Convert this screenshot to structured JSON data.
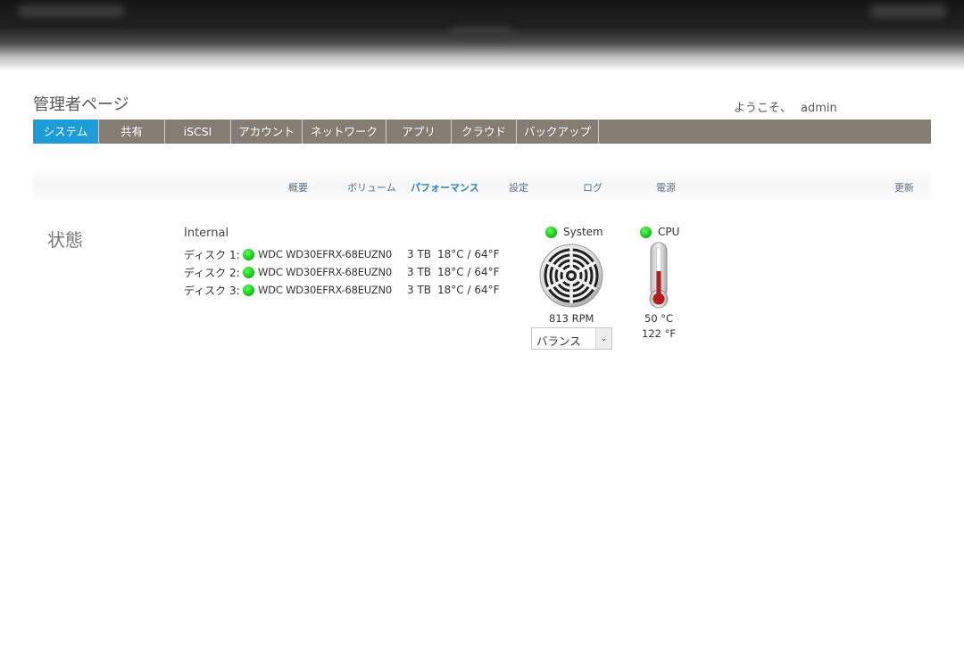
{
  "header": {
    "page_title": "管理者ページ",
    "welcome_text": "ようこそ、",
    "username": "admin"
  },
  "main_nav": {
    "tabs": [
      "システム",
      "共有",
      "iSCSI",
      "アカウント",
      "ネットワーク",
      "アプリ",
      "クラウド",
      "バックアップ"
    ],
    "active": "システム",
    "active_color": "#1e9cd8",
    "bar_color": "#857c74"
  },
  "sub_nav": {
    "items": [
      "概要",
      "ボリューム",
      "パフォーマンス",
      "設定",
      "ログ",
      "電源",
      "更新"
    ],
    "active": "パフォーマンス"
  },
  "status": {
    "title": "状態",
    "internal_label": "Internal",
    "disks": [
      {
        "label": "ディスク 1:",
        "status_color": "#16c516",
        "model": "WDC WD30EFRX-68EUZN0",
        "size": "3 TB",
        "temp": "18°C / 64°F"
      },
      {
        "label": "ディスク 2:",
        "status_color": "#16c516",
        "model": "WDC WD30EFRX-68EUZN0",
        "size": "3 TB",
        "temp": "18°C / 64°F"
      },
      {
        "label": "ディスク 3:",
        "status_color": "#16c516",
        "model": "WDC WD30EFRX-68EUZN0",
        "size": "3 TB",
        "temp": "18°C / 64°F"
      }
    ],
    "system": {
      "label": "System",
      "status_color": "#16c516",
      "fan_speed": "813 RPM",
      "fan_mode": "バランス",
      "icon": "fan-icon"
    },
    "cpu": {
      "label": "CPU",
      "status_color": "#16c516",
      "temp_c": "50 °C",
      "temp_f": "122 °F",
      "icon": "thermometer-icon"
    }
  }
}
